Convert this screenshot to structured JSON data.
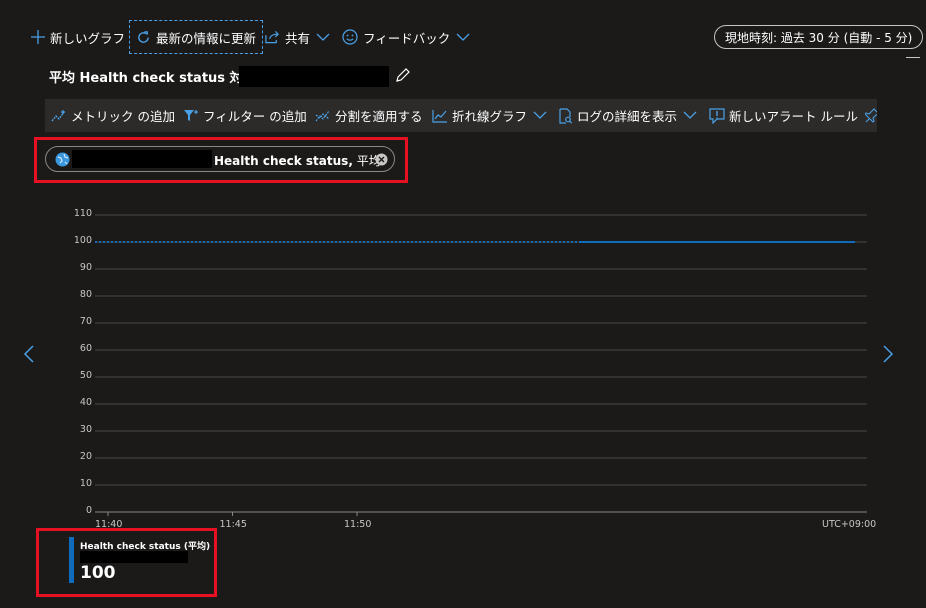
{
  "command_bar": {
    "new_chart": "新しいグラフ",
    "refresh": "最新の情報に更新",
    "share": "共有",
    "feedback": "フィードバック",
    "time_range": "現地時刻: 過去 30 分 (自動 - 5 分)"
  },
  "chart_title": "平均 Health check status 対象",
  "toolbar": {
    "add_metric": "メトリック の追加",
    "add_filter": "フィルター の追加",
    "apply_split": "分割を適用する",
    "line_chart": "折れ線グラフ",
    "drill_logs": "ログの詳細を表示",
    "new_alert": "新しいアラート ルール",
    "pin": "ダッ"
  },
  "metric_pill": {
    "label": "Health check status,",
    "aggregation": " 平均"
  },
  "chart_data": {
    "type": "line",
    "y_ticks": [
      "110",
      "100",
      "90",
      "80",
      "70",
      "60",
      "50",
      "40",
      "30",
      "20",
      "10",
      "0"
    ],
    "ylim": [
      0,
      110
    ],
    "x_ticks": [
      "11:40",
      "11:45",
      "11:50"
    ],
    "timezone": "UTC+09:00",
    "series": [
      {
        "name": "Health check status (平均)",
        "segments": [
          {
            "style": "dashed",
            "x": [
              "11:40",
              "11:59"
            ],
            "y": [
              100,
              100
            ]
          },
          {
            "style": "solid",
            "x": [
              "11:59",
              "12:10"
            ],
            "y": [
              100,
              100
            ]
          }
        ],
        "color": "#0f6cbd"
      }
    ]
  },
  "legend": {
    "series_name": "Health check status (平均)",
    "value": "100"
  },
  "colors": {
    "accent": "#0f6cbd",
    "highlight_border": "#e81123"
  }
}
